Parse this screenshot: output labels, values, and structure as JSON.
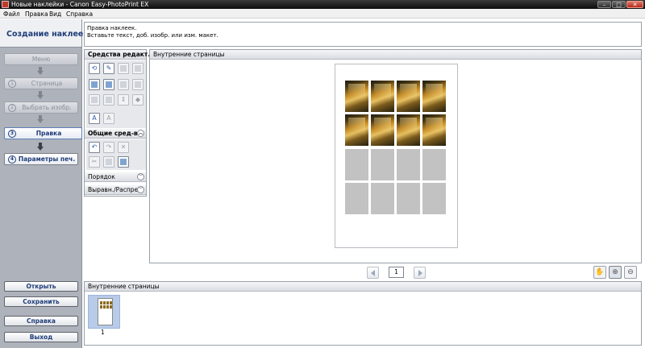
{
  "window": {
    "title": "Новые наклейки - Canon Easy-PhotoPrint EX",
    "controls": [
      "–",
      "□",
      "✕"
    ]
  },
  "menu": [
    "Файл",
    "Правка",
    "Вид",
    "Справка"
  ],
  "sidebar": {
    "title": "Создание наклеек",
    "steps": [
      {
        "num": "",
        "label": "Меню"
      },
      {
        "num": "1",
        "label": "Страница"
      },
      {
        "num": "2",
        "label": "Выбрать изобр."
      },
      {
        "num": "3",
        "label": "Правка"
      },
      {
        "num": "4",
        "label": "Параметры печ."
      }
    ],
    "buttons": {
      "open": "Открыть",
      "save": "Сохранить",
      "help": "Справка",
      "exit": "Выход"
    }
  },
  "instructions": {
    "line1": "Правка наклеек.",
    "line2": "Вставьте текст, доб. изобр. или изм. макет."
  },
  "tools": {
    "edit_tools_header": "Средства редакт.",
    "common_tools_header": "Общие сред-ва",
    "order_header": "Порядок",
    "align_header": "Выравн./Распред."
  },
  "preview": {
    "header": "Внутренние страницы",
    "page_number": "1"
  },
  "thumbnails": {
    "header": "Внутренние страницы",
    "items": [
      {
        "label": "1"
      }
    ]
  },
  "colors": {
    "sidebar_bg": "#aeb2ba",
    "accent": "#1e3c78",
    "placeholder_cell": "#c2c2c2",
    "thumb_selected": "#b8cbe8"
  }
}
